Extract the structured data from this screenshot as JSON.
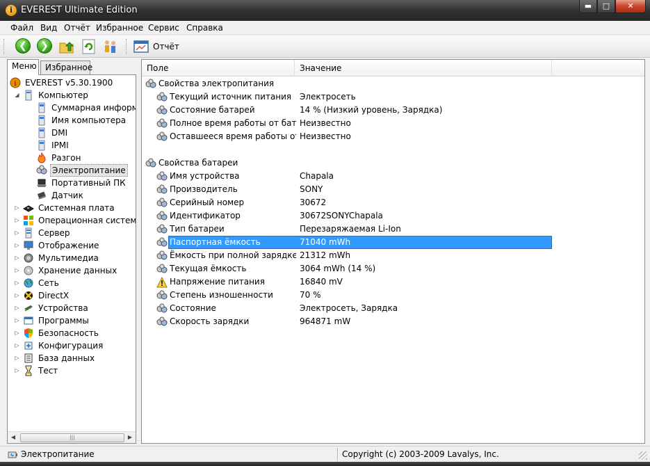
{
  "window": {
    "title": "EVEREST Ultimate Edition",
    "controls": {
      "minimize": "▬",
      "maximize": "□",
      "close": "✕"
    }
  },
  "menu": [
    "Файл",
    "Вид",
    "Отчёт",
    "Избранное",
    "Сервис",
    "Справка"
  ],
  "toolbar": {
    "report_label": "Отчёт"
  },
  "tabs": [
    "Меню",
    "Избранное"
  ],
  "tree": [
    {
      "label": "EVEREST v5.30.1900",
      "icon": "everest-info-icon"
    },
    {
      "label": "Компьютер",
      "icon": "computer-icon",
      "expander": "◢"
    },
    {
      "label": "Суммарная информация",
      "icon": "computer-summary-icon"
    },
    {
      "label": "Имя компьютера",
      "icon": "computer-name-icon"
    },
    {
      "label": "DMI",
      "icon": "dmi-icon"
    },
    {
      "label": "IPMI",
      "icon": "ipmi-icon"
    },
    {
      "label": "Разгон",
      "icon": "overclock-flame-icon"
    },
    {
      "label": "Электропитание",
      "icon": "power-management-icon"
    },
    {
      "label": "Портативный ПК",
      "icon": "laptop-icon"
    },
    {
      "label": "Датчик",
      "icon": "sensor-chip-icon"
    },
    {
      "label": "Системная плата",
      "icon": "motherboard-icon",
      "expander": "▷"
    },
    {
      "label": "Операционная система",
      "icon": "windows-os-icon",
      "expander": "▷"
    },
    {
      "label": "Сервер",
      "icon": "server-icon",
      "expander": "▷"
    },
    {
      "label": "Отображение",
      "icon": "display-monitor-icon",
      "expander": "▷"
    },
    {
      "label": "Мультимедиа",
      "icon": "multimedia-speaker-icon",
      "expander": "▷"
    },
    {
      "label": "Хранение данных",
      "icon": "storage-disk-icon",
      "expander": "▷"
    },
    {
      "label": "Сеть",
      "icon": "network-globe-icon",
      "expander": "▷"
    },
    {
      "label": "DirectX",
      "icon": "directx-icon",
      "expander": "▷"
    },
    {
      "label": "Устройства",
      "icon": "devices-icon",
      "expander": "▷"
    },
    {
      "label": "Программы",
      "icon": "software-programs-icon",
      "expander": "▷"
    },
    {
      "label": "Безопасность",
      "icon": "security-shield-icon",
      "expander": "▷"
    },
    {
      "label": "Конфигурация",
      "icon": "configuration-icon",
      "expander": "▷"
    },
    {
      "label": "База данных",
      "icon": "database-icon",
      "expander": "▷"
    },
    {
      "label": "Тест",
      "icon": "benchmark-hourglass-icon",
      "expander": "▷"
    }
  ],
  "tree_scroll": {
    "left": "◀",
    "right": "▶",
    "grip": "|||"
  },
  "columns": {
    "field": "Поле",
    "value": "Значение"
  },
  "groups": [
    {
      "title": "Свойства электропитания",
      "rows": [
        {
          "field": "Текущий источник питания",
          "value": "Электросеть"
        },
        {
          "field": "Состояние батарей",
          "value": "14 % (Низкий уровень, Зарядка)"
        },
        {
          "field": "Полное время работы от бата...",
          "value": "Неизвестно"
        },
        {
          "field": "Оставшееся время работы от ...",
          "value": "Неизвестно"
        }
      ]
    },
    {
      "title": "Свойства батареи",
      "rows": [
        {
          "field": "Имя устройства",
          "value": "Chapala"
        },
        {
          "field": "Производитель",
          "value": "SONY"
        },
        {
          "field": "Серийный номер",
          "value": "30672"
        },
        {
          "field": "Идентификатор",
          "value": "30672SONYChapala"
        },
        {
          "field": "Тип батареи",
          "value": "Перезаряжаемая Li-Ion"
        },
        {
          "field": "Паспортная ёмкость",
          "value": "71040 mWh"
        },
        {
          "field": "Ёмкость при полной зарядке",
          "value": "21312 mWh"
        },
        {
          "field": "Текущая ёмкость",
          "value": "3064 mWh  (14 %)"
        },
        {
          "field": "Напряжение питания",
          "value": "16840 mV"
        },
        {
          "field": "Степень изношенности",
          "value": "70 %"
        },
        {
          "field": "Состояние",
          "value": "Электросеть, Зарядка"
        },
        {
          "field": "Скорость зарядки",
          "value": "964871 mW"
        }
      ]
    }
  ],
  "status": {
    "left": "Электропитание",
    "right": "Copyright (c) 2003-2009 Lavalys, Inc."
  }
}
